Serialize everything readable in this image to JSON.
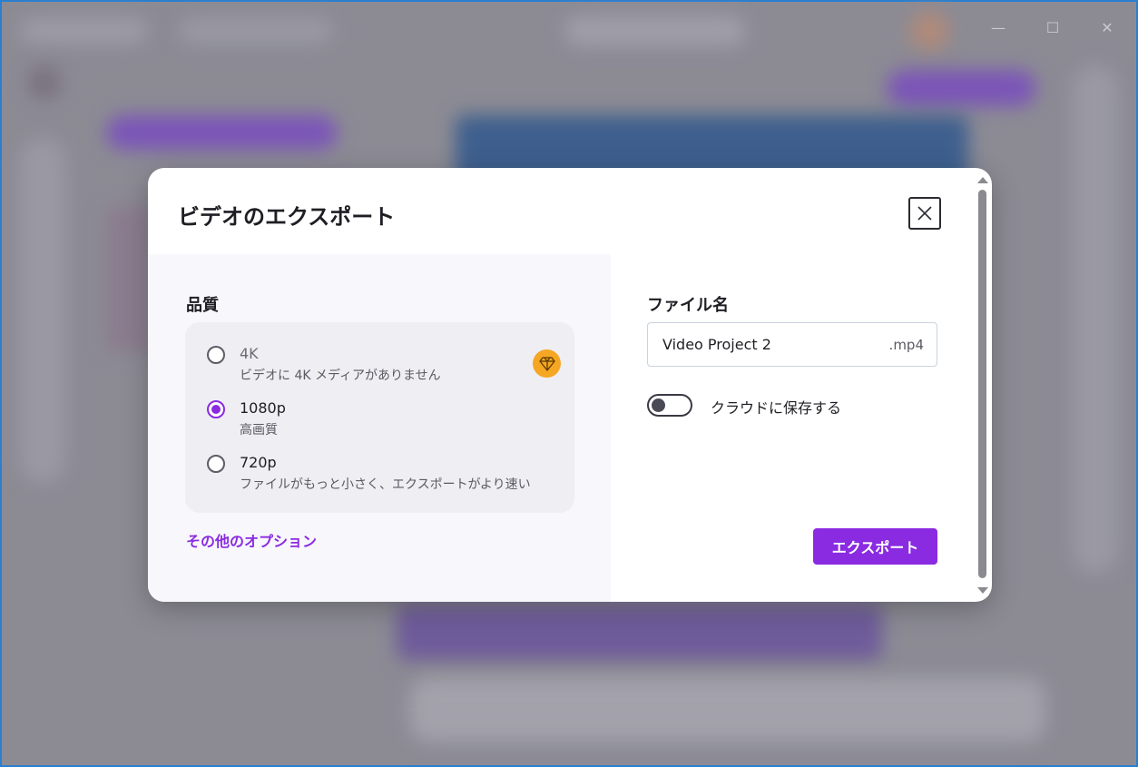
{
  "window": {
    "controls": [
      "—",
      "☐",
      "✕"
    ]
  },
  "dialog": {
    "title": "ビデオのエクスポート",
    "quality": {
      "label": "品質",
      "options": [
        {
          "title": "4K",
          "subtitle": "ビデオに 4K メディアがありません",
          "selected": false,
          "premium_icon": "gem-icon"
        },
        {
          "title": "1080p",
          "subtitle": "高画質",
          "selected": true
        },
        {
          "title": "720p",
          "subtitle": "ファイルがもっと小さく、エクスポートがより速い",
          "selected": false
        }
      ]
    },
    "more_options_label": "その他のオプション",
    "filename": {
      "label": "ファイル名",
      "value": "Video Project 2",
      "extension": ".mp4"
    },
    "cloud_save": {
      "label": "クラウドに保存する",
      "enabled": false
    },
    "export_button_label": "エクスポート"
  },
  "colors": {
    "accent": "#8a2be2",
    "premium": "#f5a623"
  }
}
